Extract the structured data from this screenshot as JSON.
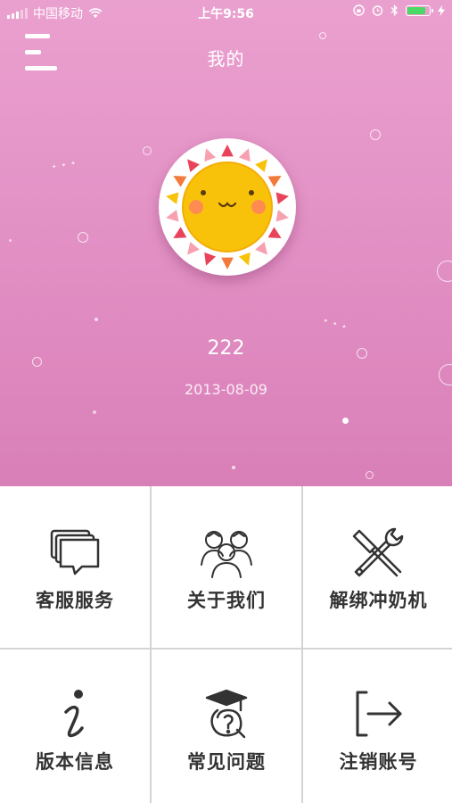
{
  "status_bar": {
    "carrier": "中国移动",
    "time": "上午9:56",
    "battery_color": "#4cd964"
  },
  "header": {
    "title": "我的",
    "menu_icon": "menu-icon"
  },
  "profile": {
    "avatar_icon": "sun-avatar-icon",
    "name": "222",
    "date": "2013-08-09"
  },
  "menu": [
    {
      "label": "客服服务",
      "icon": "customer-service-icon"
    },
    {
      "label": "关于我们",
      "icon": "about-us-icon"
    },
    {
      "label": "解绑冲奶机",
      "icon": "tools-icon"
    },
    {
      "label": "版本信息",
      "icon": "info-icon"
    },
    {
      "label": "常见问题",
      "icon": "faq-icon"
    },
    {
      "label": "注销账号",
      "icon": "logout-icon"
    }
  ],
  "colors": {
    "accent_pink": "#e392c6",
    "sun_yellow": "#f9c20a"
  }
}
